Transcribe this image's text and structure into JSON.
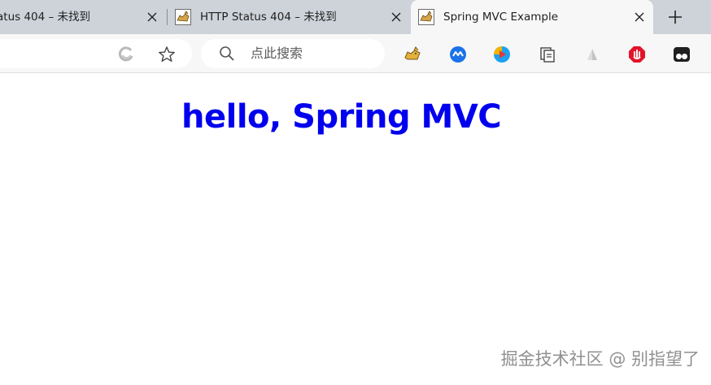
{
  "browser": {
    "tabs": [
      {
        "title": "atus 404 – 未找到",
        "active": false
      },
      {
        "title": "HTTP Status 404 – 未找到",
        "active": false
      },
      {
        "title": "Spring MVC Example",
        "active": true
      }
    ],
    "search": {
      "placeholder": "点此搜索"
    },
    "extensions": [
      "tomcat-cat-icon",
      "blue-circle-extension-icon",
      "play-extension-icon",
      "collections-icon",
      "gray-triangle-icon",
      "red-stop-icon",
      "tampermonkey-icon"
    ],
    "colors": {
      "tabstrip": "#ced3d9",
      "active_tab": "#f7f7f7",
      "toolbar": "#f7f7f7"
    }
  },
  "page": {
    "heading": "hello, Spring MVC",
    "heading_color": "#0000ee"
  },
  "watermark": "掘金技术社区 @ 别指望了"
}
